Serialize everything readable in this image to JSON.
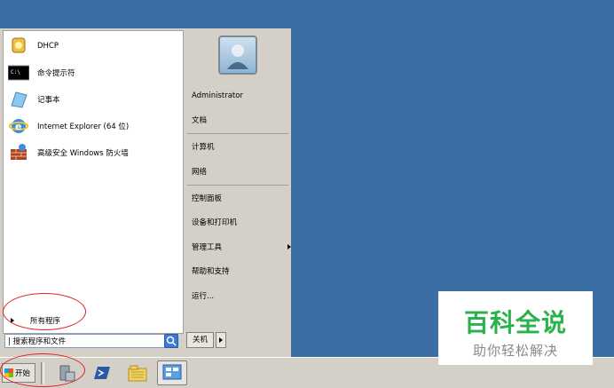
{
  "start_menu": {
    "programs": [
      {
        "label": "DHCP",
        "icon": "dhcp-icon"
      },
      {
        "label": "命令提示符",
        "icon": "cmd-icon"
      },
      {
        "label": "记事本",
        "icon": "notepad-icon"
      },
      {
        "label": "Internet Explorer (64 位)",
        "icon": "ie-icon"
      },
      {
        "label": "高级安全 Windows 防火墙",
        "icon": "firewall-icon"
      }
    ],
    "all_programs": "所有程序",
    "search_placeholder": "搜索程序和文件",
    "right_items": {
      "user": "Administrator",
      "documents": "文档",
      "computer": "计算机",
      "network": "网络",
      "control_panel": "控制面板",
      "devices_printers": "设备和打印机",
      "admin_tools": "管理工具",
      "help_support": "帮助和支持",
      "run": "运行..."
    },
    "shutdown_label": "关机"
  },
  "taskbar": {
    "start_label": "开始",
    "icons": [
      "server-manager-icon",
      "powershell-icon",
      "explorer-icon",
      "network-icon"
    ]
  },
  "watermark": {
    "title": "百科全说",
    "subtitle": "助你轻松解决"
  },
  "colors": {
    "desktop": "#3a6ea5",
    "watermark_green": "#2bb24c",
    "annotation_red": "#e02020"
  }
}
